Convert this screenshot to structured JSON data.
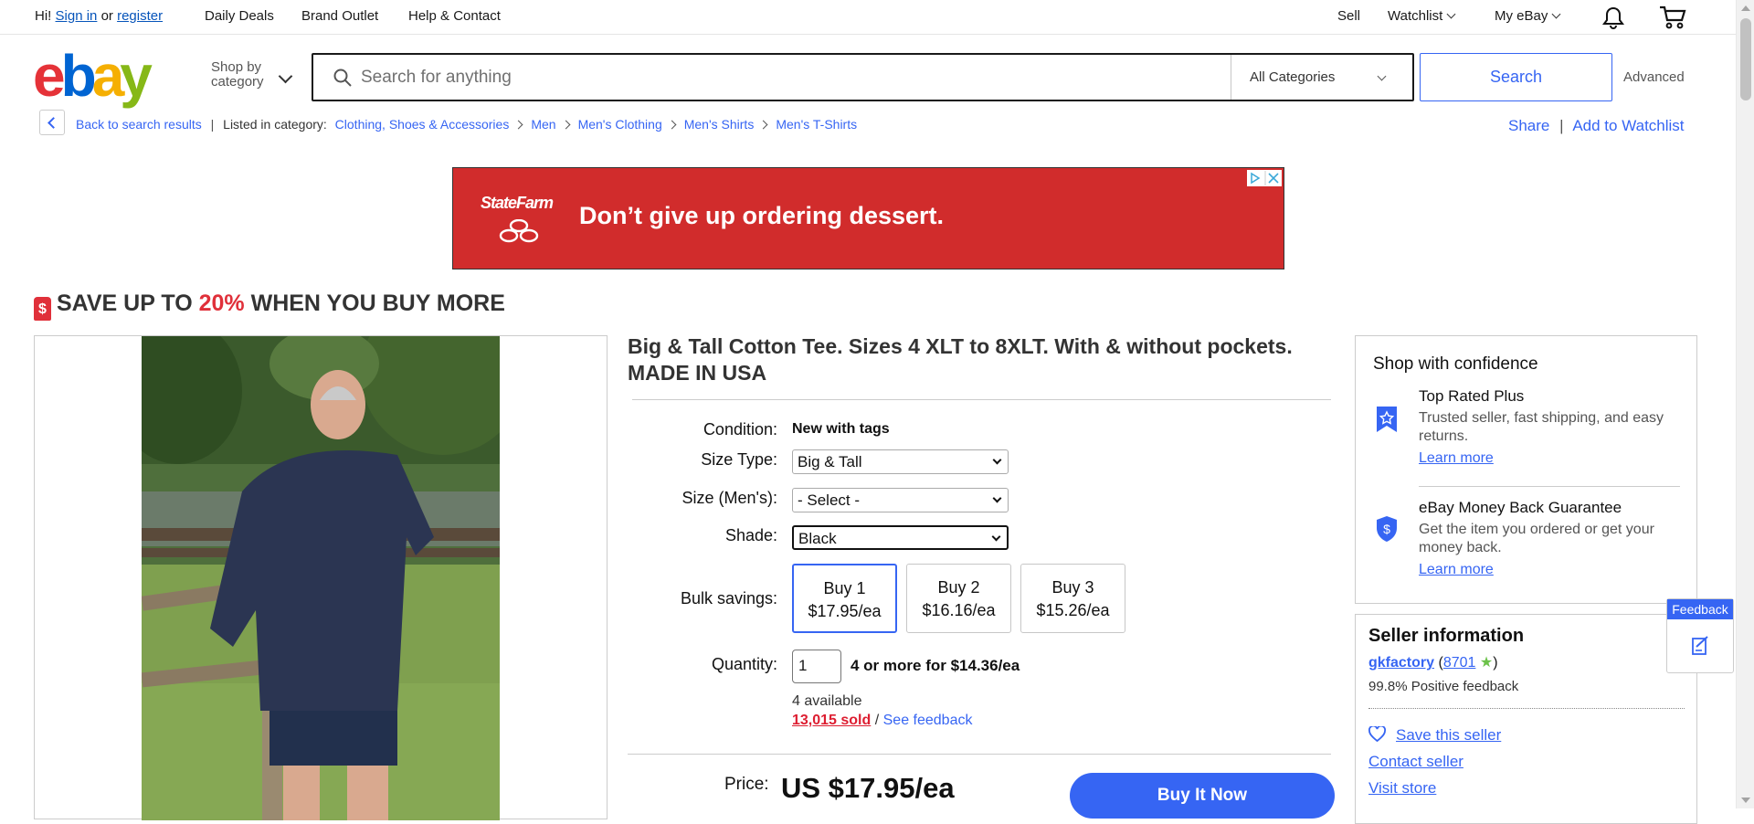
{
  "topbar": {
    "greeting_hi": "Hi!",
    "sign_in": "Sign in",
    "or": "or",
    "register": "register",
    "daily_deals": "Daily Deals",
    "brand_outlet": "Brand Outlet",
    "help_contact": "Help & Contact",
    "sell": "Sell",
    "watchlist": "Watchlist",
    "my_ebay": "My eBay",
    "notification_icon": "bell-icon",
    "cart_icon": "cart-icon"
  },
  "header": {
    "logo": [
      "e",
      "b",
      "a",
      "y"
    ],
    "logo_colors": [
      "#e53238",
      "#0064d2",
      "#f5af02",
      "#86b817"
    ],
    "shop_by_line1": "Shop by",
    "shop_by_line2": "category",
    "search_placeholder": "Search for anything",
    "category": "All Categories",
    "search_button": "Search",
    "advanced": "Advanced"
  },
  "breadcrumb": {
    "back": "Back to search results",
    "listed_in": "Listed in category:",
    "items": [
      "Clothing, Shoes & Accessories",
      "Men",
      "Men's Clothing",
      "Men's Shirts",
      "Men's T-Shirts"
    ],
    "share": "Share",
    "add_watchlist": "Add to Watchlist"
  },
  "ad": {
    "brand": "StateFarm",
    "headline": "Don’t give up ordering dessert.",
    "color": "#d12c2c"
  },
  "promo": {
    "prefix": "SAVE UP TO ",
    "percent": "20%",
    "suffix": " WHEN YOU BUY MORE",
    "tag_symbol": "$"
  },
  "item": {
    "title": "Big & Tall Cotton Tee. Sizes 4 XLT to 8XLT. With & without pockets. MADE IN USA",
    "condition_label": "Condition:",
    "condition_value": "New with tags",
    "size_type_label": "Size Type:",
    "size_type_value": "Big & Tall",
    "size_label": "Size (Men's):",
    "size_value": "- Select -",
    "shade_label": "Shade:",
    "shade_value": "Black",
    "bulk_label": "Bulk savings:",
    "bulk": [
      {
        "qty": "Buy 1",
        "price": "$17.95/ea"
      },
      {
        "qty": "Buy 2",
        "price": "$16.16/ea"
      },
      {
        "qty": "Buy 3",
        "price": "$15.26/ea"
      }
    ],
    "quantity_label": "Quantity:",
    "quantity_value": "1",
    "quantity_deal": "4 or more for $14.36/ea",
    "available": "4 available",
    "sold": "13,015 sold",
    "sold_sep": " / ",
    "see_feedback": "See feedback",
    "price_label": "Price:",
    "price": "US $17.95/ea",
    "buy_now": "Buy It Now"
  },
  "confidence": {
    "title": "Shop with confidence",
    "items": [
      {
        "title": "Top Rated Plus",
        "desc": "Trusted seller, fast shipping, and easy returns.",
        "link": "Learn more"
      },
      {
        "title": "eBay Money Back Guarantee",
        "desc": "Get the item you ordered or get your money back.",
        "link": "Learn more"
      }
    ]
  },
  "seller": {
    "title": "Seller information",
    "name": "gkfactory",
    "score": "8701",
    "positive": "99.8% Positive feedback",
    "save": "Save this seller",
    "contact": "Contact seller",
    "visit": "Visit store"
  },
  "feedback_tab": {
    "label": "Feedback"
  }
}
